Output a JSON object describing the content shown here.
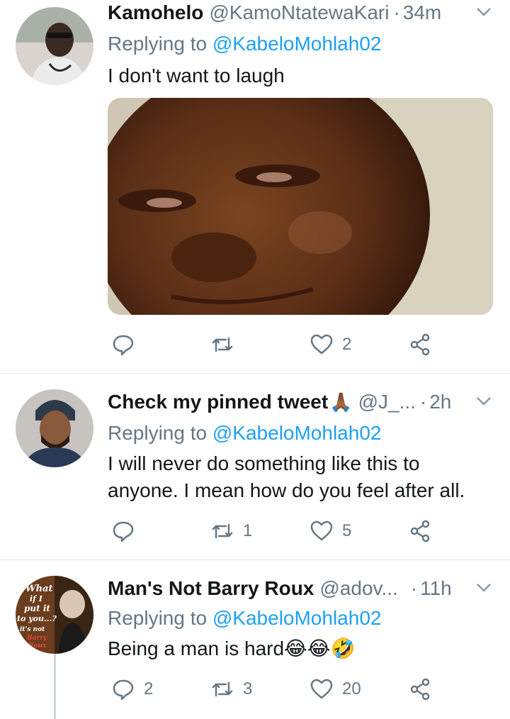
{
  "tweets": [
    {
      "name": "Kamohelo",
      "handle": "@KamoNtatewaKari",
      "dot": "·",
      "time": "34m",
      "replying_prefix": "Replying to",
      "replying_to": "@KabeloMohlah02",
      "text": "I don't want to laugh",
      "has_media": true,
      "actions": {
        "reply": "",
        "retweet": "",
        "like": "2"
      }
    },
    {
      "name": "Check my pinned tweet",
      "name_emoji": "🙏🏾",
      "handle": "@J_...",
      "dot": "·",
      "time": "2h",
      "replying_prefix": "Replying to",
      "replying_to": "@KabeloMohlah02",
      "text_line1": "I will never do something like this to",
      "text_line2": "anyone. I mean how do you feel after all.",
      "actions": {
        "reply": "",
        "retweet": "1",
        "like": "5"
      }
    },
    {
      "name": "Man's Not Barry Roux",
      "handle": "@adov...",
      "dot": "·",
      "time": "11h",
      "replying_prefix": "Replying to",
      "replying_to": "@KabeloMohlah02",
      "text": "Being a man is hard",
      "text_emojis": "😂😂🤣",
      "avatar_text": [
        "What",
        "if I",
        "put it",
        "to you...?",
        "it's not",
        "Barry",
        "Roux"
      ],
      "actions": {
        "reply": "2",
        "retweet": "3",
        "like": "20"
      }
    }
  ],
  "icons": {
    "reply": "reply-icon",
    "retweet": "retweet-icon",
    "like": "heart-icon",
    "share": "share-icon",
    "menu": "chevron-down-icon"
  },
  "colors": {
    "text": "#14171a",
    "secondary": "#657786",
    "link": "#1da1f2",
    "divider": "#e1e8ed"
  }
}
